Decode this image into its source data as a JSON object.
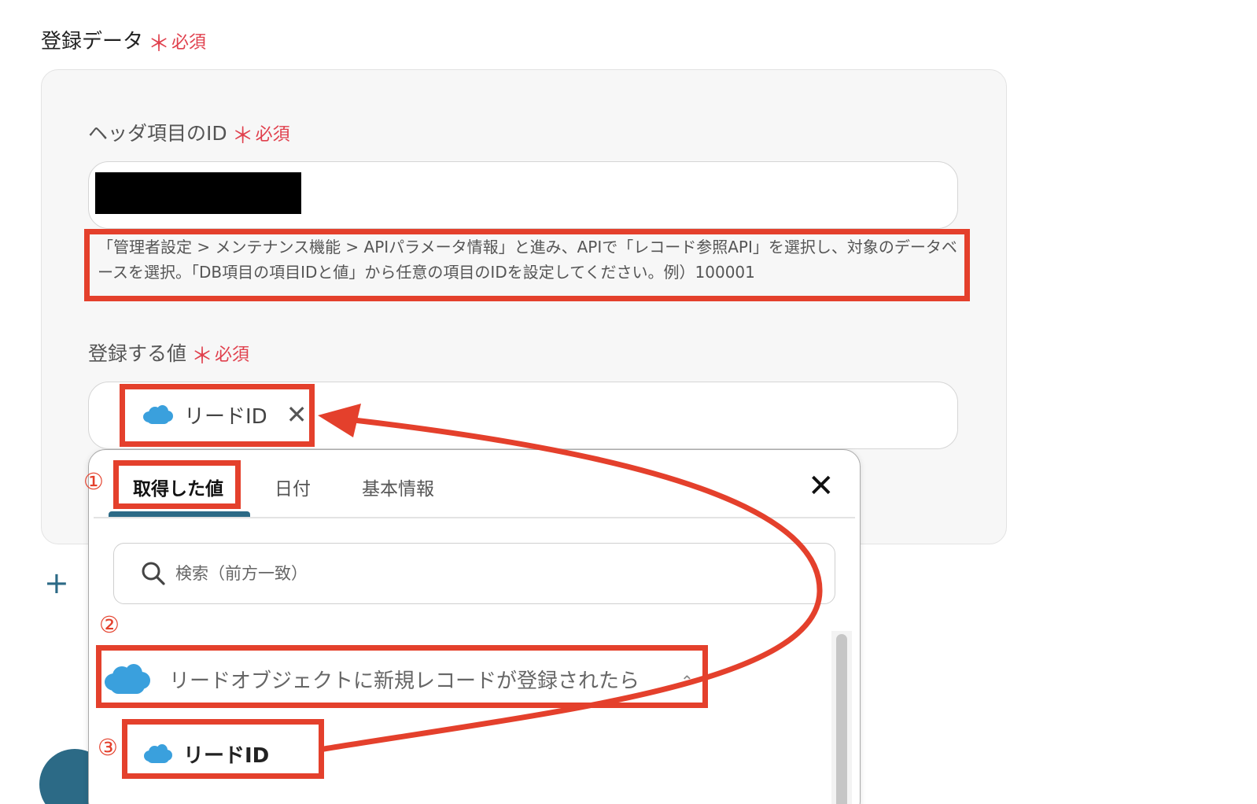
{
  "section": {
    "title": "登録データ",
    "required_mark": "＊",
    "required_text": "必須"
  },
  "header_id_field": {
    "label": "ヘッダ項目のID",
    "required_mark": "＊",
    "required_text": "必須",
    "value": ""
  },
  "hint": "「管理者設定 > メンテナンス機能 > APIパラメータ情報」と進み、APIで「レコード参照API」を選択し、対象のデータベースを選択。「DB項目の項目IDと値」から任意の項目のIDを設定してください。例）100001",
  "value_field": {
    "label": "登録する値",
    "required_mark": "＊",
    "required_text": "必須",
    "chip_label": "リードID",
    "chip_remove": "✕"
  },
  "add_row": {
    "icon": "plus-icon",
    "label": "+"
  },
  "dropdown": {
    "tabs": [
      {
        "label": "取得した値"
      },
      {
        "label": "日付"
      },
      {
        "label": "基本情報"
      }
    ],
    "close": "✕",
    "search_placeholder": "検索（前方一致）",
    "group_label": "リードオブジェクトに新規レコードが登録されたら",
    "group_chevron": "⌃",
    "item_label": "リードID"
  },
  "annotations": {
    "step1": "①",
    "step2": "②",
    "step3": "③"
  },
  "colors": {
    "accent": "#2c6a86",
    "annotation": "#e4402c",
    "required": "#e0404d",
    "salesforce": "#3aa0dd"
  },
  "icons": {
    "salesforce": "salesforce-cloud-icon",
    "search": "search-icon",
    "close": "close-icon",
    "remove": "remove-icon",
    "chevron": "chevron-up-icon"
  }
}
